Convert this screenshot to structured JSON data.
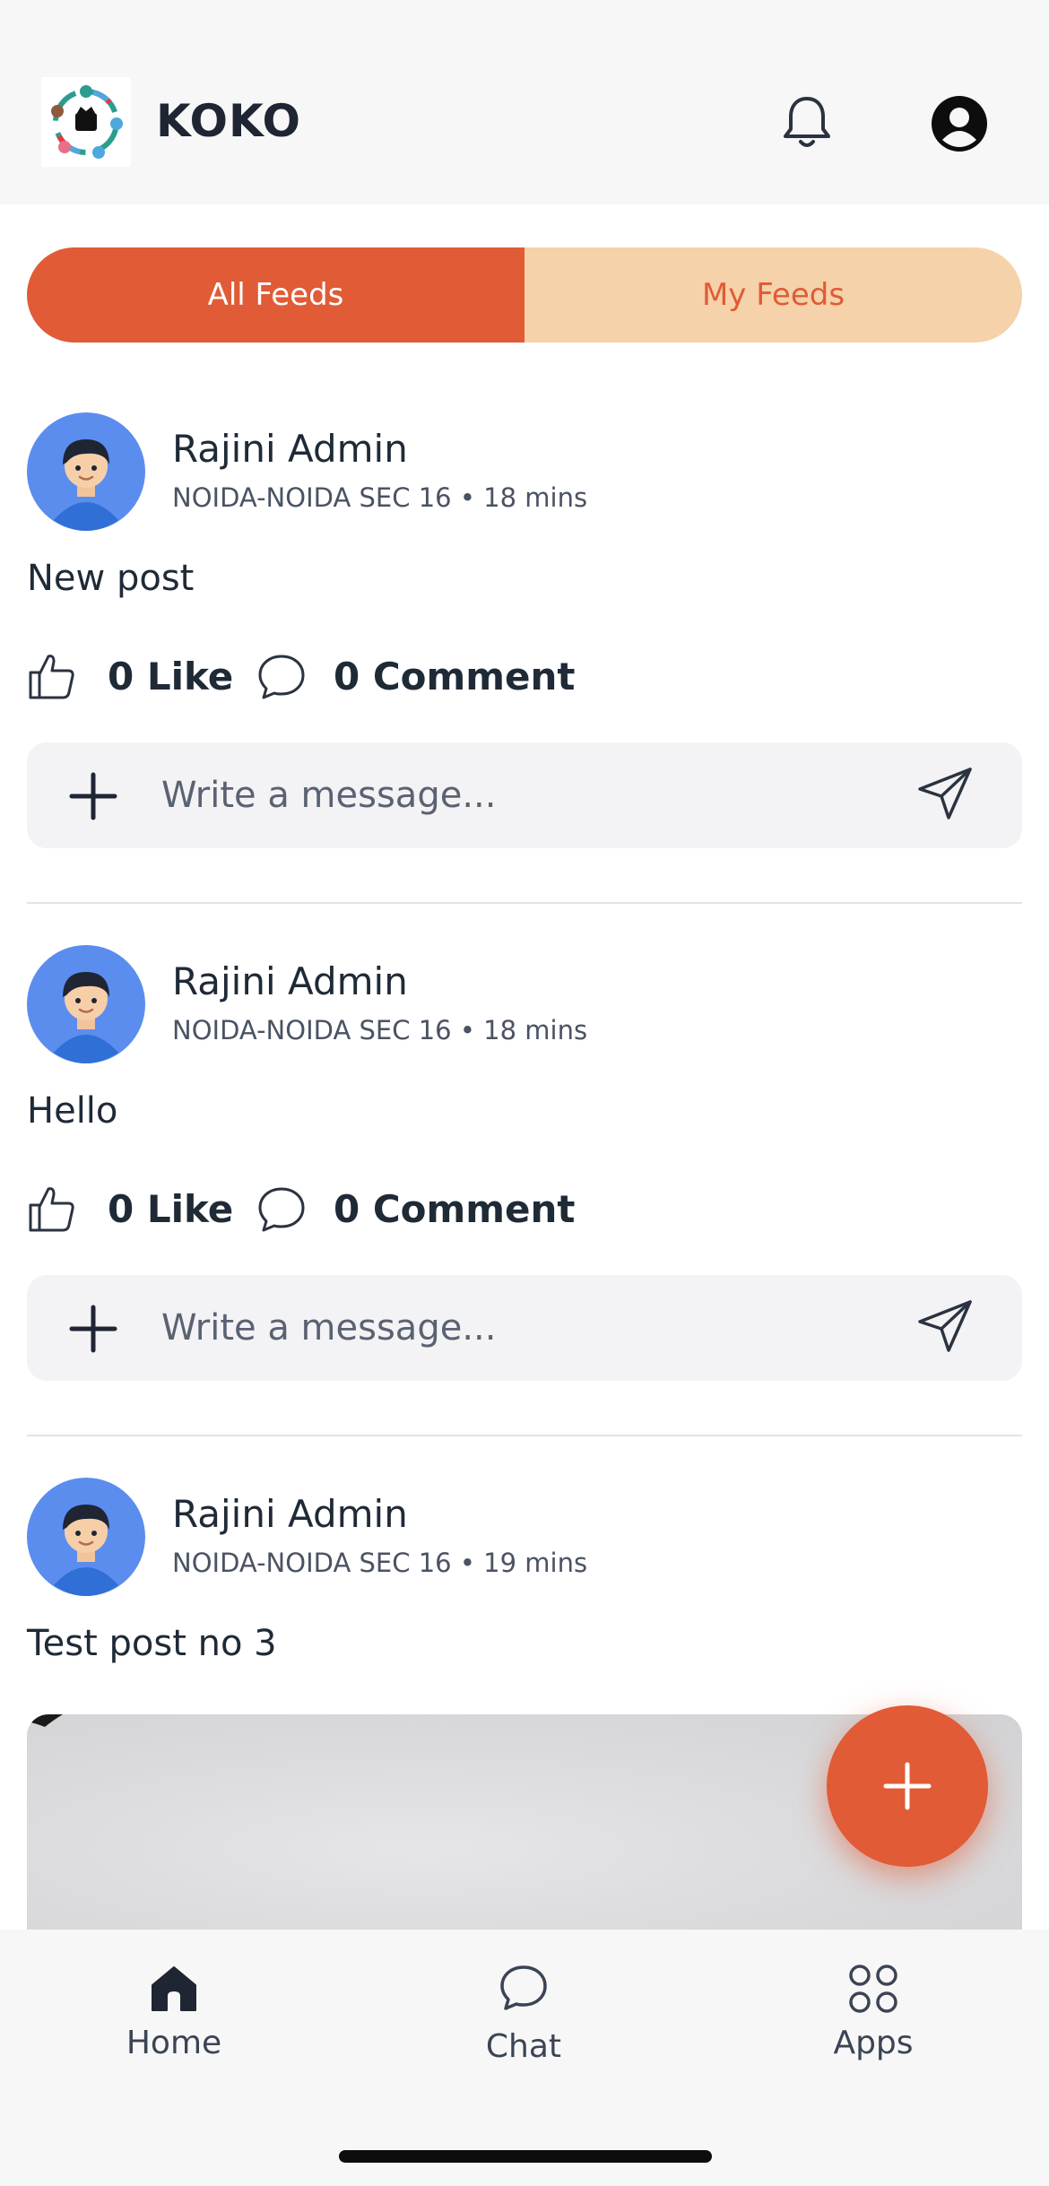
{
  "app": {
    "title": "KOKO"
  },
  "tabs": {
    "all_feeds": "All Feeds",
    "my_feeds": "My Feeds"
  },
  "posts": [
    {
      "author": "Rajini Admin",
      "location": "NOIDA-NOIDA SEC 16",
      "time": "18 mins",
      "meta": "NOIDA-NOIDA SEC 16 • 18 mins",
      "text": "New post",
      "likes_label": "0 Like",
      "comments_label": "0 Comment"
    },
    {
      "author": "Rajini Admin",
      "location": "NOIDA-NOIDA SEC 16",
      "time": "18 mins",
      "meta": "NOIDA-NOIDA SEC 16 • 18 mins",
      "text": "Hello",
      "likes_label": "0 Like",
      "comments_label": "0 Comment"
    },
    {
      "author": "Rajini Admin",
      "location": "NOIDA-NOIDA SEC 16",
      "time": "19 mins",
      "meta": "NOIDA-NOIDA SEC 16 • 19 mins",
      "text": "Test post no 3"
    }
  ],
  "composer": {
    "placeholder": "Write a message..."
  },
  "nav": {
    "home": "Home",
    "chat": "Chat",
    "apps": "Apps"
  },
  "colors": {
    "accent": "#e05b36",
    "accent_light": "#f5d2a9",
    "text": "#1f2a37",
    "avatar_bg": "#5b8def"
  },
  "icons": [
    "logo-icon",
    "bell-icon",
    "profile-icon",
    "like-icon",
    "comment-icon",
    "plus-icon",
    "send-icon",
    "fab-plus-icon",
    "home-icon",
    "chat-icon",
    "apps-icon"
  ]
}
